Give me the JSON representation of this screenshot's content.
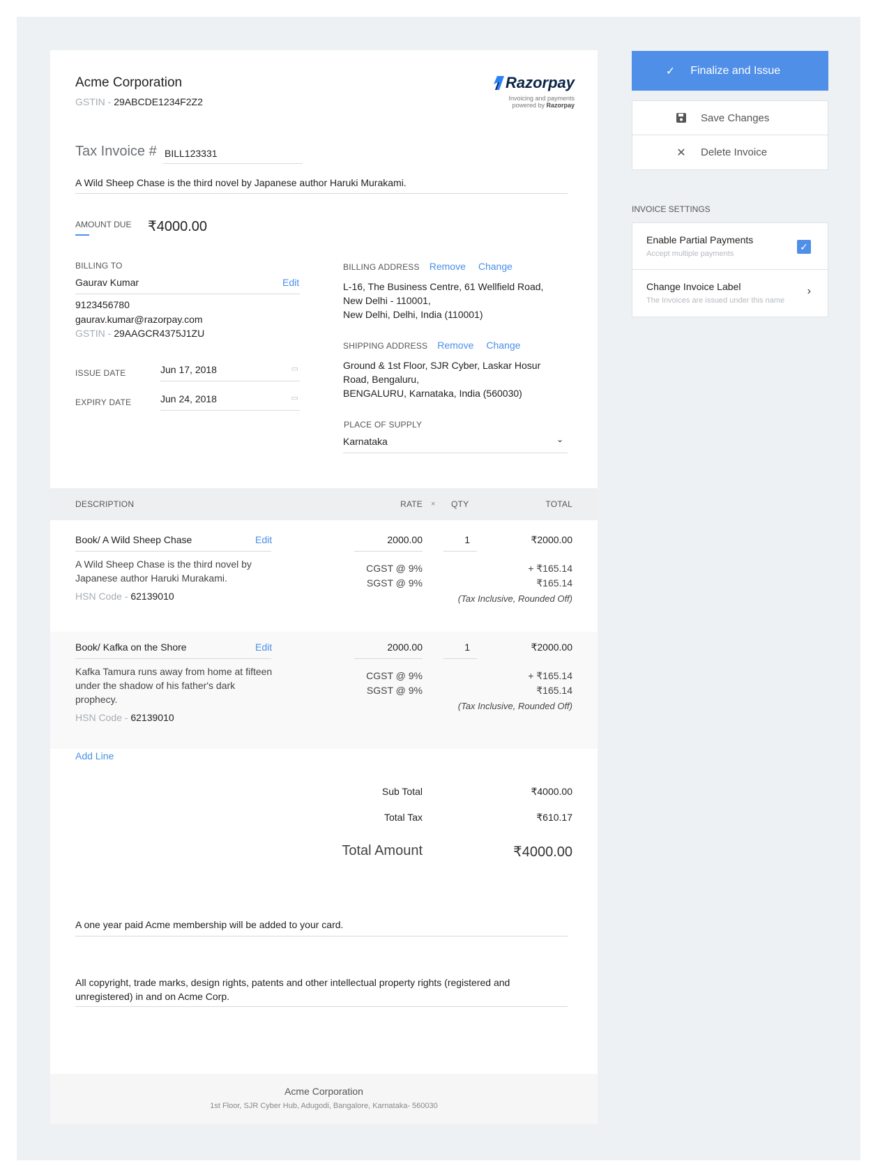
{
  "invoice": {
    "company_name": "Acme Corporation",
    "gstin_label": "GSTIN -",
    "gstin_value": "29ABCDE1234F2Z2",
    "brand": "Razorpay",
    "brand_tagline_1": "Invoicing and payments",
    "brand_tagline_2": "powered by",
    "brand_tagline_2_strong": "Razorpay",
    "title_label": "Tax Invoice #",
    "invoice_number": "BILL123331",
    "description": "A Wild Sheep Chase is the third novel by Japanese author Haruki Murakami.",
    "amount_due_label": "AMOUNT DUE",
    "amount_due_value": "₹4000.00"
  },
  "billing_to": {
    "label": "BILLING TO",
    "name": "Gaurav Kumar",
    "edit": "Edit",
    "phone": "9123456780",
    "email": "gaurav.kumar@razorpay.com",
    "gstin_label": "GSTIN -",
    "gstin_value": "29AAGCR4375J1ZU"
  },
  "dates": {
    "issue_label": "ISSUE DATE",
    "issue_value": "Jun 17, 2018",
    "expiry_label": "EXPIRY DATE",
    "expiry_value": "Jun 24, 2018"
  },
  "billing_address": {
    "label": "BILLING ADDRESS",
    "remove": "Remove",
    "change": "Change",
    "line1": "L-16, The Business Centre, 61 Wellfield Road,",
    "line2": "New Delhi - 110001,",
    "line3": "New Delhi, Delhi, India (110001)"
  },
  "shipping_address": {
    "label": "SHIPPING ADDRESS",
    "remove": "Remove",
    "change": "Change",
    "line1": "Ground & 1st Floor, SJR Cyber, Laskar Hosur",
    "line2": "Road, Bengaluru,",
    "line3": "BENGALURU, Karnataka, India (560030)"
  },
  "place_of_supply": {
    "label": "PLACE OF SUPPLY",
    "value": "Karnataka"
  },
  "table": {
    "col_description": "DESCRIPTION",
    "col_rate": "RATE",
    "col_times": "×",
    "col_qty": "QTY",
    "col_total": "TOTAL"
  },
  "items": [
    {
      "name": "Book/ A Wild Sheep Chase",
      "edit": "Edit",
      "desc_1": "A Wild Sheep Chase is the third novel by",
      "desc_2": "Japanese author Haruki Murakami.",
      "hsn_label": "HSN Code -",
      "hsn_value": "62139010",
      "rate": "2000.00",
      "qty": "1",
      "total": "₹2000.00",
      "cgst_label": "CGST @ 9%",
      "cgst_value": "+ ₹165.14",
      "sgst_label": "SGST @ 9%",
      "sgst_value": "₹165.14",
      "note": "(Tax Inclusive, Rounded Off)"
    },
    {
      "name": "Book/ Kafka on the Shore",
      "edit": "Edit",
      "desc_1": "Kafka Tamura runs away from home at fifteen",
      "desc_2": "under the shadow of his father's dark",
      "desc_3": "prophecy.",
      "hsn_label": "HSN Code -",
      "hsn_value": "62139010",
      "rate": "2000.00",
      "qty": "1",
      "total": "₹2000.00",
      "cgst_label": "CGST @ 9%",
      "cgst_value": "+ ₹165.14",
      "sgst_label": "SGST @ 9%",
      "sgst_value": "₹165.14",
      "note": "(Tax Inclusive, Rounded Off)"
    }
  ],
  "add_line": "Add Line",
  "totals": {
    "subtotal_label": "Sub Total",
    "subtotal_value": "₹4000.00",
    "tax_label": "Total Tax",
    "tax_value": "₹610.17",
    "total_label": "Total Amount",
    "total_value": "₹4000.00"
  },
  "notes": {
    "note_1": "A one year paid Acme membership will be added to your card.",
    "terms_1": "All copyright, trade marks, design rights, patents and other intellectual property rights (registered and",
    "terms_2": "unregistered) in and on Acme Corp."
  },
  "footer": {
    "company": "Acme Corporation",
    "address": "1st Floor, SJR Cyber Hub, Adugodi, Bangalore, Karnataka- 560030"
  },
  "sidebar": {
    "finalize": "Finalize and Issue",
    "save": "Save Changes",
    "delete": "Delete Invoice",
    "settings_label": "INVOICE SETTINGS",
    "partial_title": "Enable Partial Payments",
    "partial_sub": "Accept multiple payments",
    "partial_checked": true,
    "label_title": "Change Invoice Label",
    "label_sub": "The Invoices are issued under this name"
  },
  "colors": {
    "accent": "#4f8fe8",
    "link": "#4a8fe7",
    "background": "#eef1f4"
  }
}
